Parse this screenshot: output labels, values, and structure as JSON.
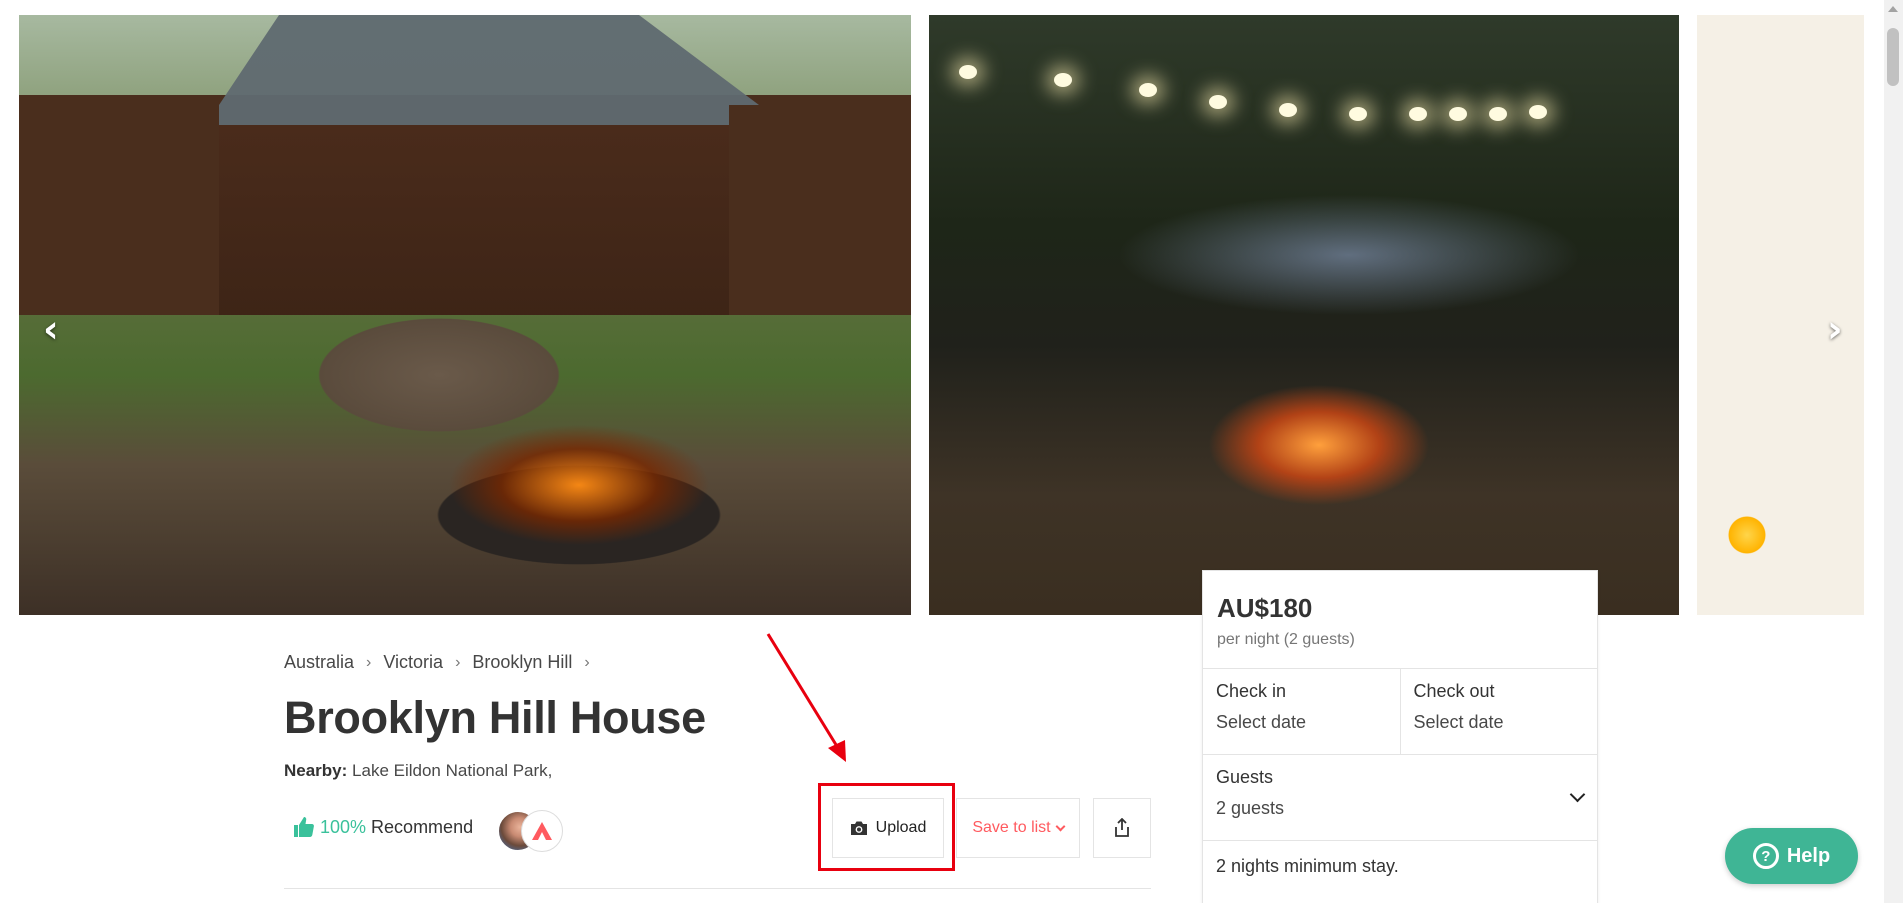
{
  "gallery": {
    "photos": [
      "photo-cabin-firepit",
      "photo-night-concert",
      "photo-food-platter"
    ],
    "prev_icon": "chevron-left-icon",
    "next_icon": "chevron-right-icon",
    "prev_glyph": "‹",
    "next_glyph": "›"
  },
  "breadcrumb": {
    "items": [
      "Australia",
      "Victoria",
      "Brooklyn Hill"
    ],
    "separator": "›"
  },
  "listing": {
    "title": "Brooklyn Hill House",
    "nearby_label": "Nearby:",
    "nearby_value": "Lake Eildon National Park,"
  },
  "recommend": {
    "percent": "100%",
    "label": "Recommend"
  },
  "actions": {
    "upload_label": "Upload",
    "save_label": "Save to list",
    "save_chevron": "⌄"
  },
  "booking": {
    "price": "AU$180",
    "per_night": "per night (2 guests)",
    "checkin_label": "Check in",
    "checkin_value": "Select date",
    "checkout_label": "Check out",
    "checkout_value": "Select date",
    "guests_label": "Guests",
    "guests_value": "2 guests",
    "min_stay": "2 nights minimum stay."
  },
  "help": {
    "label": "Help",
    "icon_glyph": "?"
  },
  "colors": {
    "brand_red": "#ff5a5f",
    "recommend_green": "#3ac19b",
    "help_green": "#3fb595",
    "annotation_red": "#e8000f"
  }
}
